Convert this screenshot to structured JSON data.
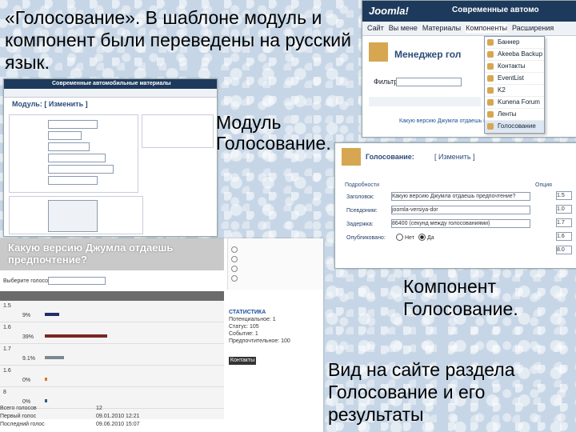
{
  "slide": {
    "intro": "«Голосование». В шаблоне модуль и компонент были переведены на русский язык.",
    "module_caption": "Модуль Голосование.",
    "component_caption": "Компонент Голосование.",
    "site_caption": "Вид на сайте раздела Голосование и его результаты"
  },
  "admin_top": {
    "logo": "Joomla!",
    "site_title": "Современные автомо",
    "menu": [
      "Сайт",
      "Вы мене",
      "Материалы",
      "Компоненты",
      "Расширения"
    ],
    "manager_title": "Менеджер гол",
    "filter_label": "Фильтр",
    "item_text": "Какую версию Джумла отдаешь пре",
    "dropdown": [
      "Баннер",
      "Akeeba Backup",
      "Контакты",
      "EventList",
      "K2",
      "Kunena Forum",
      "Ленты новостей",
      "Голосование"
    ]
  },
  "module_shot": {
    "header": "Современные автомобильные материалы",
    "title": "Модуль: [ Изменить ]"
  },
  "component_shot": {
    "title": "Голосование:",
    "title_link": "[ Изменить ]",
    "section": "Подробности",
    "options_label": "Опция",
    "fields": [
      {
        "label": "Заголовок:",
        "value": "Какую версию Джумла отдаешь предпочтение?"
      },
      {
        "label": "Псевдоним:",
        "value": "joomla-versiya-dor"
      },
      {
        "label": "Задержка:",
        "value": "86400 (секунд между голосованиями)"
      }
    ],
    "published_label": "Опубликовано:",
    "radio_no": "Нет",
    "radio_yes": "Да",
    "option_values": [
      "1.5",
      "1.0",
      "1.7",
      "1.6",
      "8.0"
    ]
  },
  "site_shot": {
    "heading": "Какую версию Джумла отдаешь предпочтение?",
    "select_label": "Выберите голосование",
    "stats_title": "СТАТИСТИКА",
    "stats_lines": [
      "Потенциальное: 1",
      "Статус: 105",
      "Событие: 1",
      "Предпочтительное: 100"
    ],
    "contacts": "Контакты",
    "results": [
      {
        "version": "1.5",
        "pct": "9%",
        "frac": 0.09,
        "color": "#1f2f6a"
      },
      {
        "version": "1.6",
        "pct": "39%",
        "frac": 0.39,
        "color": "#7a2626"
      },
      {
        "version": "1.7",
        "pct": "9.1%",
        "frac": 0.12,
        "color": "#7c8792"
      },
      {
        "version": "1.6",
        "pct": "0%",
        "frac": 0.0,
        "color": "#cf7b2a"
      },
      {
        "version": "8",
        "pct": "0%",
        "frac": 0.0,
        "color": "#2a5a8f"
      }
    ],
    "footer": [
      {
        "k": "Всего голосов",
        "v": "12"
      },
      {
        "k": "Первый голос",
        "v": "09.01.2010 12:21"
      },
      {
        "k": "Последний голос",
        "v": "09.06.2010 15:07"
      }
    ]
  },
  "colors": {
    "joomla_bar": "#1d3a5c",
    "link": "#24406a",
    "accent": "#e6a02a"
  }
}
